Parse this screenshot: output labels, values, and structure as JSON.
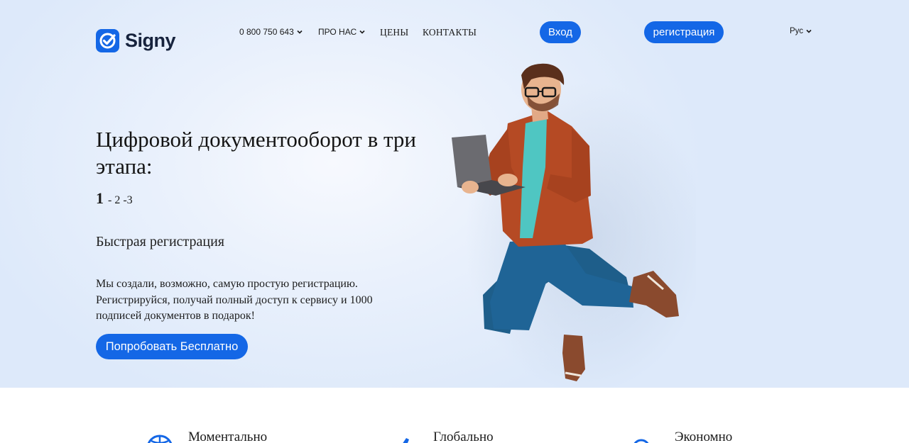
{
  "header": {
    "logo_text": "Signy",
    "phone": "0 800 750 643",
    "about": "ПРО НАС",
    "prices": "ЦЕНЫ",
    "contacts": "КОНТАКТЫ",
    "login_label": "Вход",
    "register_label": "регистрация",
    "language": "Рус"
  },
  "hero": {
    "headline": "Цифровой документооборот в три этапа:",
    "steps": {
      "active": "1",
      "rest": "- 2 -3"
    },
    "subhead": "Быстрая регистрация",
    "description": "Мы создали, возможно, самую простую регистрацию. Регистрируйся, получай полный доступ к сервису и 1000 подписей документов в подарок!",
    "cta_label": "Попробовать Бесплатно"
  },
  "features": [
    {
      "title": "Моментально",
      "icon": "globe-icon"
    },
    {
      "title": "Глобально",
      "icon": "plane-icon"
    },
    {
      "title": "Экономно",
      "icon": "coin-icon"
    }
  ],
  "colors": {
    "accent": "#1467e6",
    "hero_bg": "#e3edfb"
  }
}
